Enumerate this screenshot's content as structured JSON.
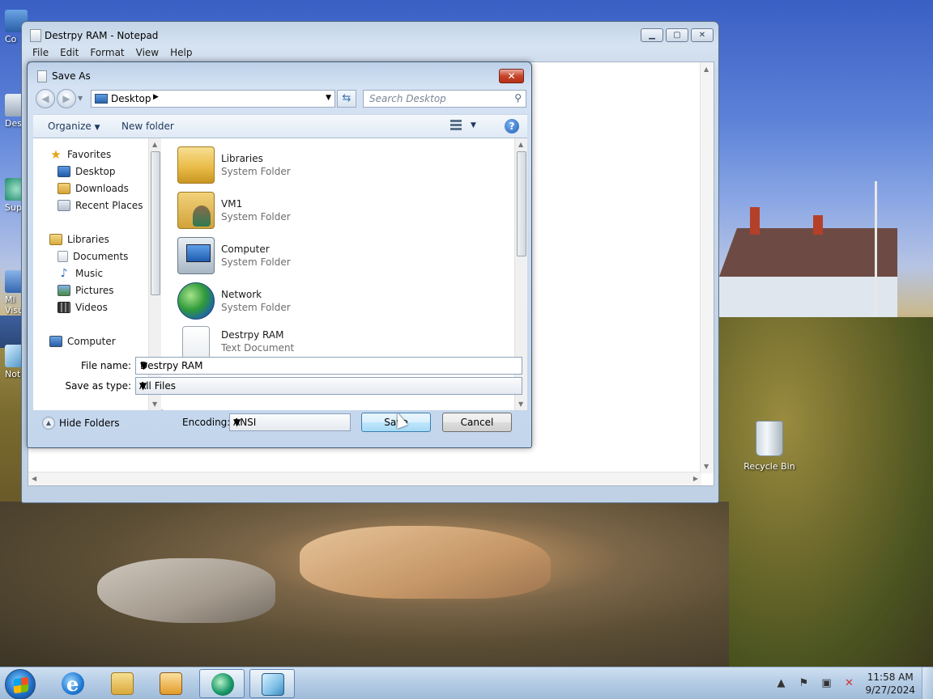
{
  "desktop": {
    "icons": [
      {
        "label": "Co"
      },
      {
        "label": "Desk"
      },
      {
        "label": "Sup"
      },
      {
        "label": "Mi\nVisu"
      },
      {
        "label": "Not"
      }
    ],
    "recycle_bin_label": "Recycle Bin"
  },
  "notepad": {
    "title": "Destrpy RAM - Notepad",
    "menu": [
      "File",
      "Edit",
      "Format",
      "View",
      "Help"
    ]
  },
  "dialog": {
    "title": "Save As",
    "address": "Desktop",
    "search_placeholder": "Search Desktop",
    "toolbar": {
      "organize": "Organize",
      "new_folder": "New folder"
    },
    "nav_pane": {
      "favorites": "Favorites",
      "favorites_items": [
        "Desktop",
        "Downloads",
        "Recent Places"
      ],
      "libraries": "Libraries",
      "libraries_items": [
        "Documents",
        "Music",
        "Pictures",
        "Videos"
      ],
      "computer": "Computer"
    },
    "files": [
      {
        "name": "Libraries",
        "type": "System Folder",
        "icon": "libraries-icon"
      },
      {
        "name": "VM1",
        "type": "System Folder",
        "icon": "user-folder-icon"
      },
      {
        "name": "Computer",
        "type": "System Folder",
        "icon": "computer-icon"
      },
      {
        "name": "Network",
        "type": "System Folder",
        "icon": "network-icon"
      },
      {
        "name": "Destrpy RAM",
        "type": "Text Document",
        "icon": "text-document-icon"
      }
    ],
    "file_name_label": "File name:",
    "file_name_value": "Destrpy RAM",
    "save_type_label": "Save as type:",
    "save_type_value": "All Files",
    "hide_folders": "Hide Folders",
    "encoding_label": "Encoding:",
    "encoding_value": "ANSI",
    "save_button": "Save",
    "cancel_button": "Cancel"
  },
  "taskbar": {
    "time": "11:58 AM",
    "date": "9/27/2024"
  }
}
